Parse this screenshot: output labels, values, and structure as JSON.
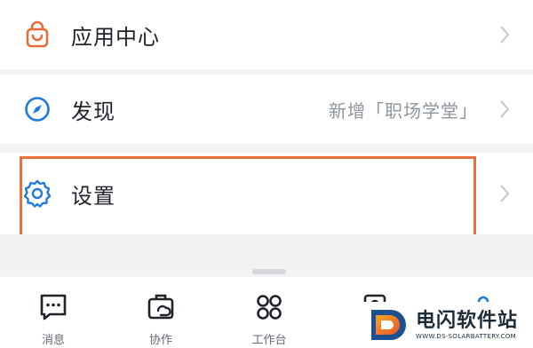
{
  "menu": {
    "app_center": {
      "label": "应用中心",
      "icon": "shopping-bag-icon",
      "icon_color": "#e36c3a"
    },
    "discover": {
      "label": "发现",
      "subtitle": "新增「职场学堂」",
      "icon": "compass-icon",
      "icon_color": "#1f7ae0"
    },
    "settings": {
      "label": "设置",
      "icon": "gear-icon",
      "icon_color": "#1f7ae0"
    }
  },
  "highlight_color": "#e8703a",
  "tabbar": {
    "items": [
      {
        "label": "消息",
        "icon": "chat-bubble-icon"
      },
      {
        "label": "协作",
        "icon": "briefcase-icon"
      },
      {
        "label": "工作台",
        "icon": "grid-icon"
      },
      {
        "label": "",
        "icon": "contacts-icon"
      },
      {
        "label": "",
        "icon": "profile-icon"
      }
    ]
  },
  "watermark": {
    "title": "电闪软件站",
    "url": "WWW.DS-SOLARBATTERY.COM"
  }
}
